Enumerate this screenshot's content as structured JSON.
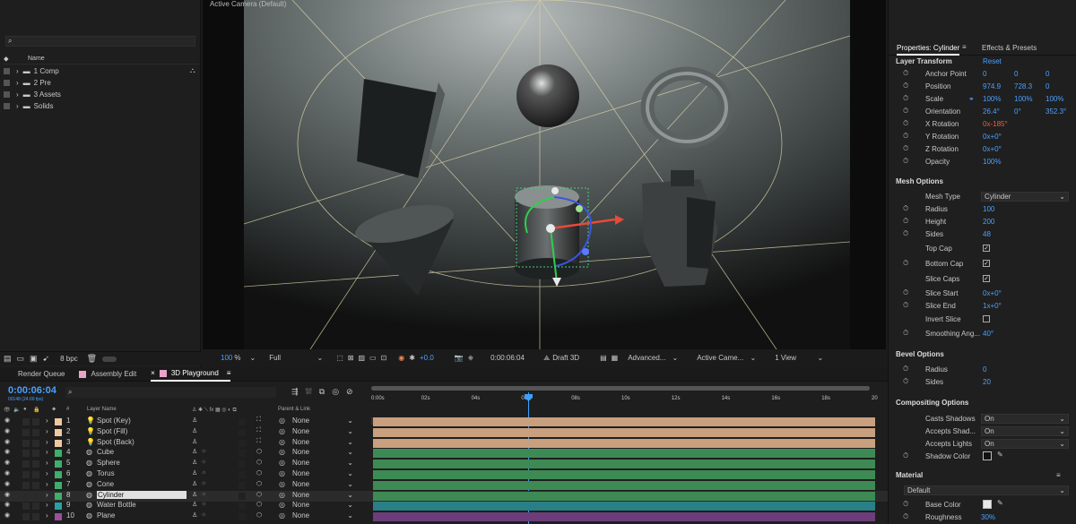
{
  "project": {
    "search_placeholder": "",
    "col_name": "Name",
    "items": [
      {
        "name": "1 Comp",
        "has_flow": true
      },
      {
        "name": "2 Pre"
      },
      {
        "name": "3 Assets"
      },
      {
        "name": "Solids"
      }
    ],
    "bpc": "8 bpc"
  },
  "viewer": {
    "label": "Active Camera (Default)",
    "zoom": "100",
    "zoom_unit": "%",
    "resolution": "Full",
    "exposure": "+0.0",
    "timecode": "0:00:06:04",
    "renderer": "Draft 3D",
    "advanced": "Advanced...",
    "camera": "Active Came...",
    "views": "1 View"
  },
  "properties": {
    "top_text": "",
    "tab_props": "Properties: Cylinder",
    "tab_effects": "Effects & Presets",
    "layer_transform": "Layer Transform",
    "reset": "Reset",
    "transform": [
      {
        "label": "Anchor Point",
        "v": [
          "0",
          "0",
          "0"
        ]
      },
      {
        "label": "Position",
        "v": [
          "974.9",
          "728.3",
          "0"
        ]
      },
      {
        "label": "Scale",
        "v": [
          "100%",
          "100%",
          "100%"
        ],
        "link": true
      },
      {
        "label": "Orientation",
        "v": [
          "26.4°",
          "0°",
          "352.3°"
        ]
      },
      {
        "label": "X Rotation",
        "v": [
          "0x-185°"
        ],
        "orange": true
      },
      {
        "label": "Y Rotation",
        "v": [
          "0x+0°"
        ]
      },
      {
        "label": "Z Rotation",
        "v": [
          "0x+0°"
        ]
      },
      {
        "label": "Opacity",
        "v": [
          "100%"
        ]
      }
    ],
    "mesh_options": "Mesh Options",
    "mesh_type_label": "Mesh Type",
    "mesh_type": "Cylinder",
    "mesh": [
      {
        "label": "Radius",
        "v": "100",
        "stop": true
      },
      {
        "label": "Height",
        "v": "200",
        "stop": true
      },
      {
        "label": "Sides",
        "v": "48",
        "stop": true
      },
      {
        "label": "Top Cap",
        "check": true
      },
      {
        "label": "Bottom Cap",
        "check": true,
        "stop": true
      },
      {
        "label": "Slice Caps",
        "check": true
      },
      {
        "label": "Slice Start",
        "v": "0x+0°",
        "stop": true
      },
      {
        "label": "Slice End",
        "v": "1x+0°",
        "stop": true
      },
      {
        "label": "Invert Slice",
        "check": false
      },
      {
        "label": "Smoothing Ang...",
        "v": "40°",
        "stop": true
      }
    ],
    "bevel_options": "Bevel Options",
    "bevel": [
      {
        "label": "Radius",
        "v": "0"
      },
      {
        "label": "Sides",
        "v": "20"
      }
    ],
    "compositing_options": "Compositing Options",
    "compositing": [
      {
        "label": "Casts Shadows",
        "v": "On"
      },
      {
        "label": "Accepts Shad...",
        "v": "On"
      },
      {
        "label": "Accepts Lights",
        "v": "On"
      }
    ],
    "shadow_color": "Shadow Color",
    "material": "Material",
    "material_preset": "Default",
    "base_color": "Base Color",
    "roughness": "Roughness",
    "roughness_value": "30%"
  },
  "timeline": {
    "tabs": [
      {
        "label": "Render Queue"
      },
      {
        "label": "Assembly Edit",
        "color": "#e9a3c9"
      },
      {
        "label": "3D Playground",
        "color": "#e9a3c9",
        "active": true
      }
    ],
    "timecode": "0:00:06:04",
    "timecode_sub": "00148 (24.00 fps)",
    "col_hash": "#",
    "col_layer": "Layer Name",
    "col_parent": "Parent & Link",
    "ruler": [
      "0:00s",
      "02s",
      "04s",
      "06s",
      "08s",
      "10s",
      "12s",
      "14s",
      "16s",
      "18s",
      "20"
    ],
    "layers": [
      {
        "n": "1",
        "name": "Spot (Key)",
        "kind": "light",
        "color": "#f0c8a0",
        "parent": "None",
        "bar": "#c8a07f"
      },
      {
        "n": "2",
        "name": "Spot (Fill)",
        "kind": "light",
        "color": "#f0c8a0",
        "parent": "None",
        "bar": "#c8a07f"
      },
      {
        "n": "3",
        "name": "Spot (Back)",
        "kind": "light",
        "color": "#f0c8a0",
        "parent": "None",
        "bar": "#c8a07f"
      },
      {
        "n": "4",
        "name": "Cube",
        "kind": "mesh",
        "color": "#3fae6a",
        "parent": "None",
        "bar": "#3e8a55"
      },
      {
        "n": "5",
        "name": "Sphere",
        "kind": "mesh",
        "color": "#3fae6a",
        "parent": "None",
        "bar": "#3e8a55"
      },
      {
        "n": "6",
        "name": "Torus",
        "kind": "mesh",
        "color": "#3fae6a",
        "parent": "None",
        "bar": "#3e8a55"
      },
      {
        "n": "7",
        "name": "Cone",
        "kind": "mesh",
        "color": "#3fae6a",
        "parent": "None",
        "bar": "#3e8a55"
      },
      {
        "n": "8",
        "name": "Cylinder",
        "kind": "mesh",
        "color": "#3fae6a",
        "parent": "None",
        "bar": "#3e8a55",
        "selected": true
      },
      {
        "n": "9",
        "name": "Water Bottle",
        "kind": "mesh",
        "color": "#2aa0a0",
        "parent": "None",
        "bar": "#2a7f86"
      },
      {
        "n": "10",
        "name": "Plane",
        "kind": "mesh",
        "color": "#9a4fa0",
        "parent": "None",
        "bar": "#6b3d7a"
      }
    ]
  },
  "colors": {
    "accent": "#2f8fff",
    "playhead": "#3aa0ff"
  }
}
